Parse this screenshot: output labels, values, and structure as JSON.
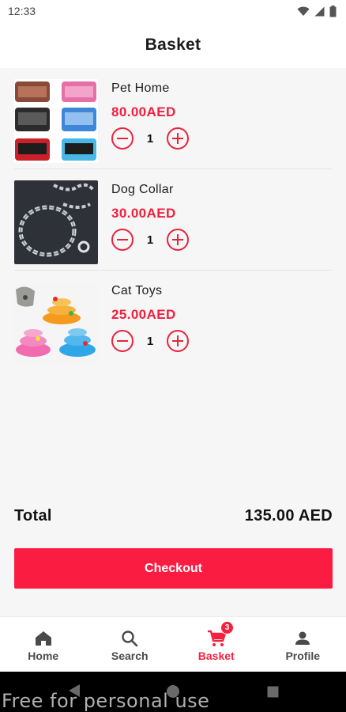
{
  "status_bar": {
    "time": "12:33"
  },
  "header": {
    "title": "Basket"
  },
  "cart": {
    "items": [
      {
        "name": "Pet Home",
        "price": "80.00AED",
        "quantity": "1",
        "image": "pet-home-playpen-image"
      },
      {
        "name": "Dog Collar",
        "price": "30.00AED",
        "quantity": "1",
        "image": "dog-collar-chain-image"
      },
      {
        "name": "Cat Toys",
        "price": "25.00AED",
        "quantity": "1",
        "image": "cat-toys-tower-image"
      }
    ],
    "total_label": "Total",
    "total_value": "135.00 AED",
    "checkout_label": "Checkout"
  },
  "bottom_nav": {
    "items": [
      {
        "label": "Home",
        "icon": "home-icon",
        "active": false
      },
      {
        "label": "Search",
        "icon": "search-icon",
        "active": false
      },
      {
        "label": "Basket",
        "icon": "cart-icon",
        "active": true,
        "badge": "3"
      },
      {
        "label": "Profile",
        "icon": "person-icon",
        "active": false
      }
    ]
  },
  "watermark": "Free for personal use",
  "colors": {
    "accent": "#fb1c42",
    "price": "#f0203e",
    "background": "#f6f6f7"
  }
}
